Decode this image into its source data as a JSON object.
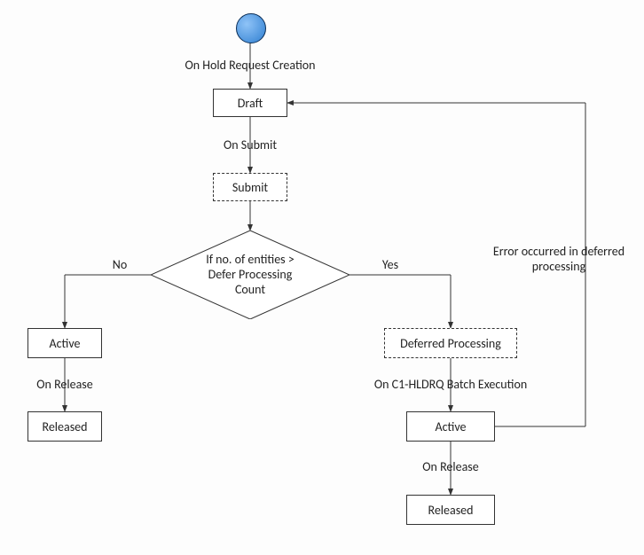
{
  "chart_data": {
    "type": "flowchart",
    "title": "",
    "nodes": [
      {
        "id": "start",
        "type": "start",
        "label": ""
      },
      {
        "id": "draft",
        "type": "process",
        "label": "Draft"
      },
      {
        "id": "submit",
        "type": "process-dashed",
        "label": "Submit"
      },
      {
        "id": "decision",
        "type": "decision",
        "label": "If no. of entities > Defer Processing Count"
      },
      {
        "id": "active_left",
        "type": "process",
        "label": "Active"
      },
      {
        "id": "released_left",
        "type": "process",
        "label": "Released"
      },
      {
        "id": "deferred",
        "type": "process-dashed",
        "label": "Deferred Processing"
      },
      {
        "id": "active_right",
        "type": "process",
        "label": "Active"
      },
      {
        "id": "released_right",
        "type": "process",
        "label": "Released"
      }
    ],
    "edges": [
      {
        "from": "start",
        "to": "draft",
        "label": "On Hold Request Creation"
      },
      {
        "from": "draft",
        "to": "submit",
        "label": "On Submit"
      },
      {
        "from": "submit",
        "to": "decision",
        "label": ""
      },
      {
        "from": "decision",
        "to": "active_left",
        "label": "No"
      },
      {
        "from": "decision",
        "to": "deferred",
        "label": "Yes"
      },
      {
        "from": "active_left",
        "to": "released_left",
        "label": "On Release"
      },
      {
        "from": "deferred",
        "to": "active_right",
        "label": "On C1-HLDRQ Batch Execution"
      },
      {
        "from": "active_right",
        "to": "released_right",
        "label": "On Release"
      },
      {
        "from": "active_right",
        "to": "draft",
        "label": "Error occurred in deferred processing"
      }
    ]
  },
  "labels": {
    "start_to_draft": "On Hold Request Creation",
    "draft": "Draft",
    "draft_to_submit": "On Submit",
    "submit": "Submit",
    "decision_line1": "If no. of entities >",
    "decision_line2": "Defer Processing",
    "decision_line3": "Count",
    "no": "No",
    "yes": "Yes",
    "active": "Active",
    "on_release": "On Release",
    "released": "Released",
    "deferred": "Deferred Processing",
    "batch_exec": "On C1-HLDRQ Batch Execution",
    "error_line1": "Error occurred in deferred",
    "error_line2": "processing"
  }
}
